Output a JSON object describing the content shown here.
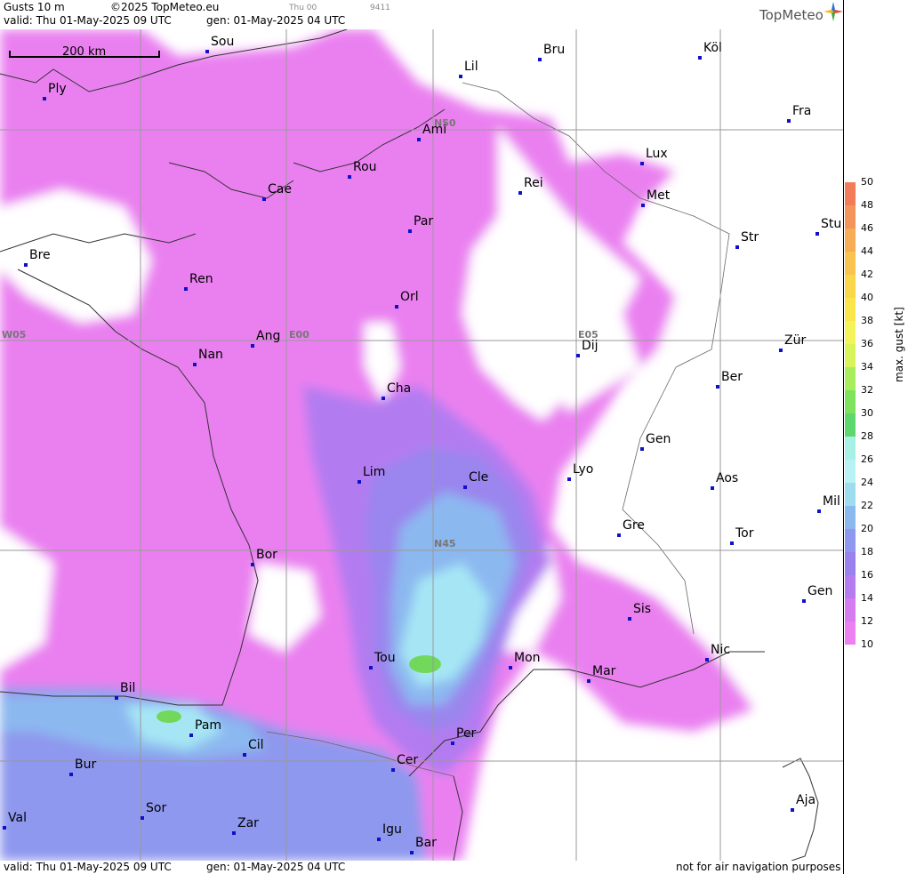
{
  "header": {
    "product": "Gusts 10 m",
    "copyright": "©2025 TopMeteo.eu",
    "valid": "valid:  Thu  01-May-2025  09 UTC",
    "gen": "gen: 01-May-2025 04 UTC",
    "small_time": "Thu 00",
    "small_code": "9411",
    "logo": "TopMeteo"
  },
  "footer": {
    "valid": "valid:  Thu  01-May-2025  09 UTC",
    "gen": "gen: 01-May-2025 04 UTC",
    "disclaimer": "not for air navigation purposes"
  },
  "scale": {
    "label": "200 km"
  },
  "grid_labels": {
    "n50": "N50",
    "n45": "N45",
    "w05": "W05",
    "e00": "E00",
    "e05": "E05"
  },
  "cities": [
    "Sou",
    "Bru",
    "Köl",
    "Lil",
    "Ply",
    "Ami",
    "Fra",
    "Lux",
    "Rou",
    "Rei",
    "Cae",
    "Met",
    "Par",
    "Stu",
    "Str",
    "Bre",
    "Ren",
    "Orl",
    "Ang",
    "Dij",
    "Zür",
    "Nan",
    "Ber",
    "Cha",
    "Gen",
    "Lim",
    "Cle",
    "Lyo",
    "Aos",
    "Mil",
    "Gre",
    "Tor",
    "Bor",
    "Gen",
    "Sis",
    "Nic",
    "Tou",
    "Mon",
    "Mar",
    "Bil",
    "Pam",
    "Per",
    "Cil",
    "Cer",
    "Bur",
    "Aja",
    "Sor",
    "Val",
    "Zar",
    "Igu",
    "Bar"
  ],
  "legend": {
    "title": "max. gust  [kt]",
    "ticks": [
      "50",
      "48",
      "46",
      "44",
      "42",
      "40",
      "38",
      "36",
      "34",
      "32",
      "30",
      "28",
      "26",
      "24",
      "22",
      "20",
      "18",
      "16",
      "14",
      "12",
      "10"
    ],
    "colors": [
      "#f27b5a",
      "#f5945a",
      "#f6ad55",
      "#f8c44e",
      "#fad64a",
      "#fbe64a",
      "#f4f45a",
      "#d8f45a",
      "#a8ee5a",
      "#7ee25c",
      "#5ed86e",
      "#a6f0e6",
      "#b8f2f4",
      "#9edcf0",
      "#8cb8f0",
      "#8e98ee",
      "#9a82ee",
      "#b47cf0",
      "#d47cf0",
      "#ec80f0"
    ],
    "min_kt": 10,
    "max_kt": 50
  }
}
